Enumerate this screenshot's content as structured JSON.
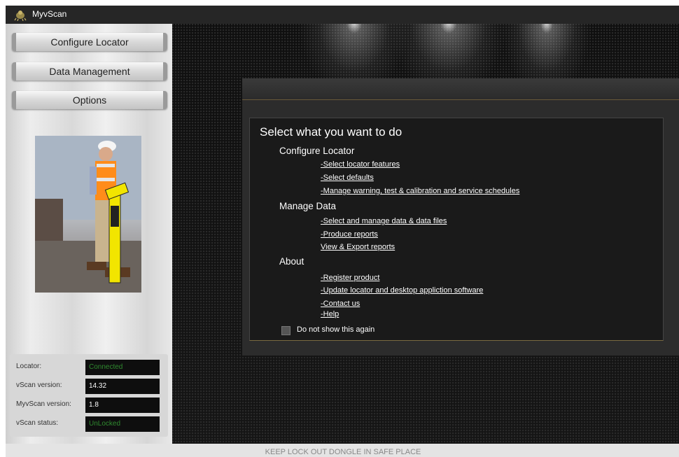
{
  "window": {
    "title": "MyvScan"
  },
  "nav": {
    "configure_locator": "Configure Locator",
    "data_management": "Data Management",
    "options": "Options"
  },
  "status": {
    "rows": [
      {
        "label": "Locator:",
        "value": "Connected",
        "color": "#2f8a2f"
      },
      {
        "label": "vScan version:",
        "value": "14.32"
      },
      {
        "label": "MyvScan version:",
        "value": "1.8"
      },
      {
        "label": "vScan status:",
        "value": "UnLocked",
        "color": "#2f8a2f"
      }
    ]
  },
  "dialog": {
    "heading": "Select what you want to do",
    "sections": [
      {
        "title": "Configure Locator",
        "links": [
          "-Select locator features",
          "-Select defaults",
          "-Manage warning, test & calibration and service schedules"
        ]
      },
      {
        "title": "Manage Data",
        "links": [
          "-Select and manage data & data files",
          "-Produce reports",
          "View & Export reports"
        ]
      },
      {
        "title": "About",
        "links": [
          "-Register product",
          "-Update locator and desktop appliction software",
          "-Contact us",
          "-Help"
        ]
      }
    ],
    "checkbox_label": "Do not show this again",
    "checkbox_checked": false
  },
  "footer": {
    "text": "KEEP LOCK OUT DONGLE IN SAFE PLACE"
  },
  "icons": {
    "app": "app-logo-icon"
  }
}
